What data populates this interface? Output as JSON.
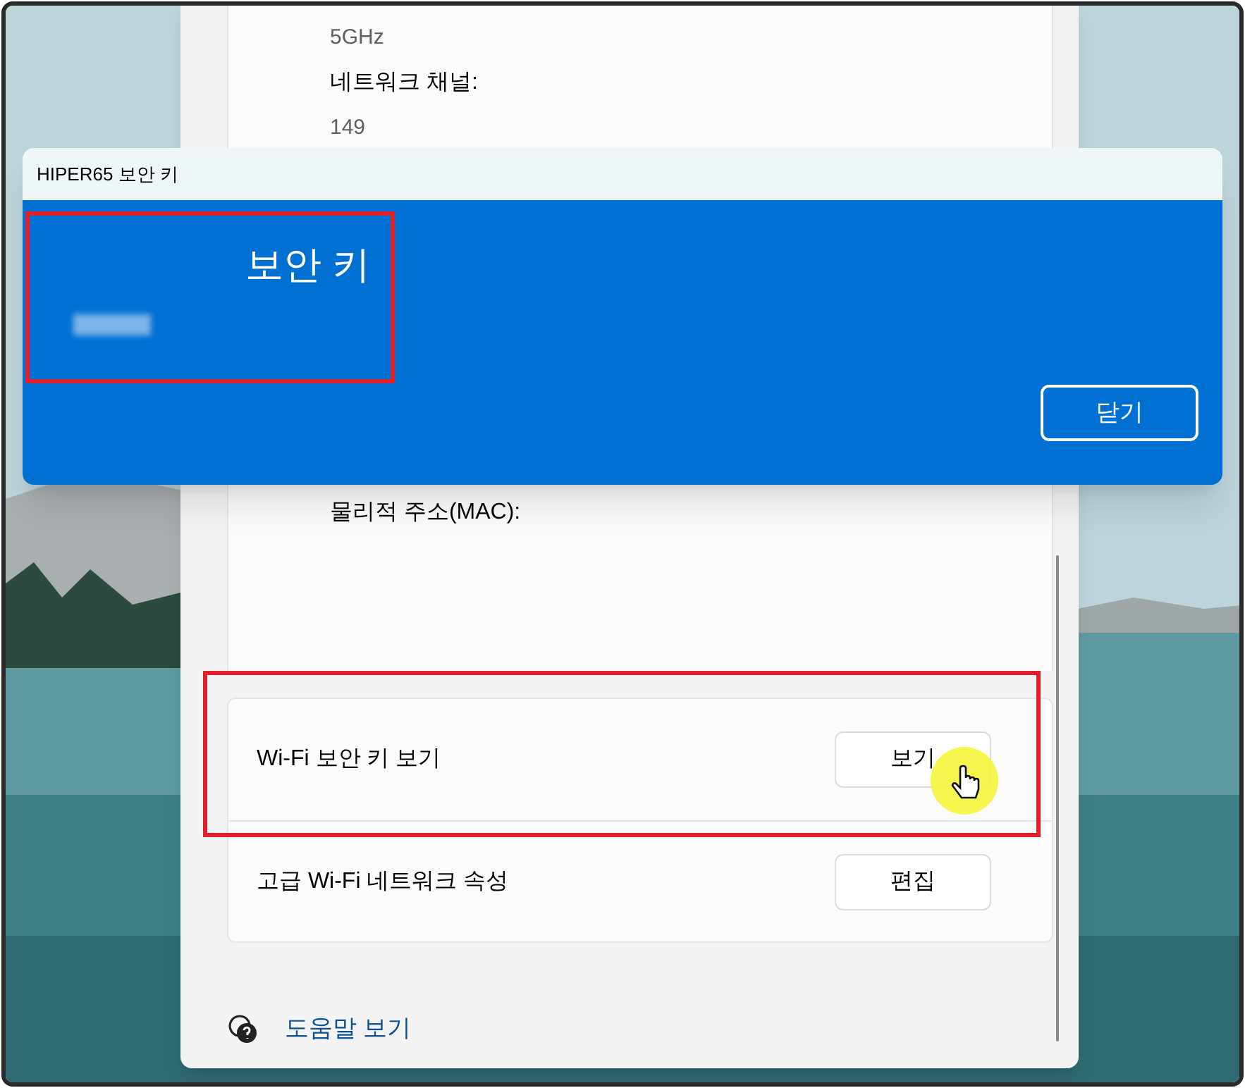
{
  "settings": {
    "details": [
      {
        "kind": "value",
        "text": "5GHz"
      },
      {
        "kind": "label",
        "text": "네트워크 채널:"
      },
      {
        "kind": "value",
        "text": "149"
      },
      {
        "kind": "label",
        "text": "물리적 주소(MAC):"
      }
    ],
    "rows": [
      {
        "label": "Wi-Fi 보안 키 보기",
        "button": "보기",
        "highlighted": true
      },
      {
        "label": "고급 Wi-Fi 네트워크 속성",
        "button": "편집",
        "highlighted": false
      }
    ],
    "help_link": "도움말 보기"
  },
  "dialog": {
    "title": "HIPER65 보안 키",
    "heading": "보안 키",
    "heading_highlighted": true,
    "close_button": "닫기"
  }
}
